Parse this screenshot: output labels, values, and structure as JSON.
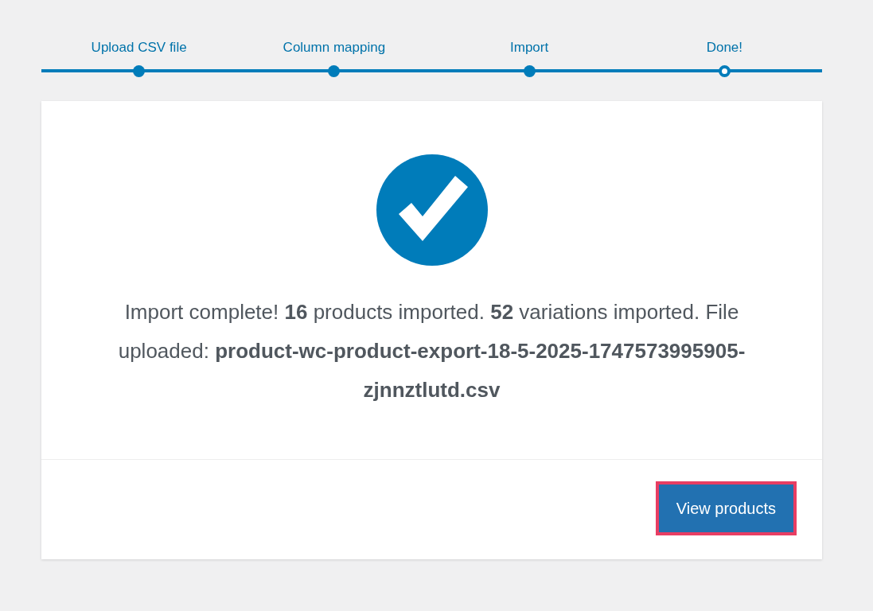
{
  "steps": [
    {
      "label": "Upload CSV file",
      "selected": false
    },
    {
      "label": "Column mapping",
      "selected": false
    },
    {
      "label": "Import",
      "selected": false
    },
    {
      "label": "Done!",
      "selected": true
    }
  ],
  "result": {
    "message": "Import complete! **16** products imported. **52** variations imported. File uploaded: **product-wc-product-export-18-5-2025-1747573995905-zjnnztlutd.csv**",
    "view_button": {
      "label": "View products",
      "highlighted": true
    }
  }
}
